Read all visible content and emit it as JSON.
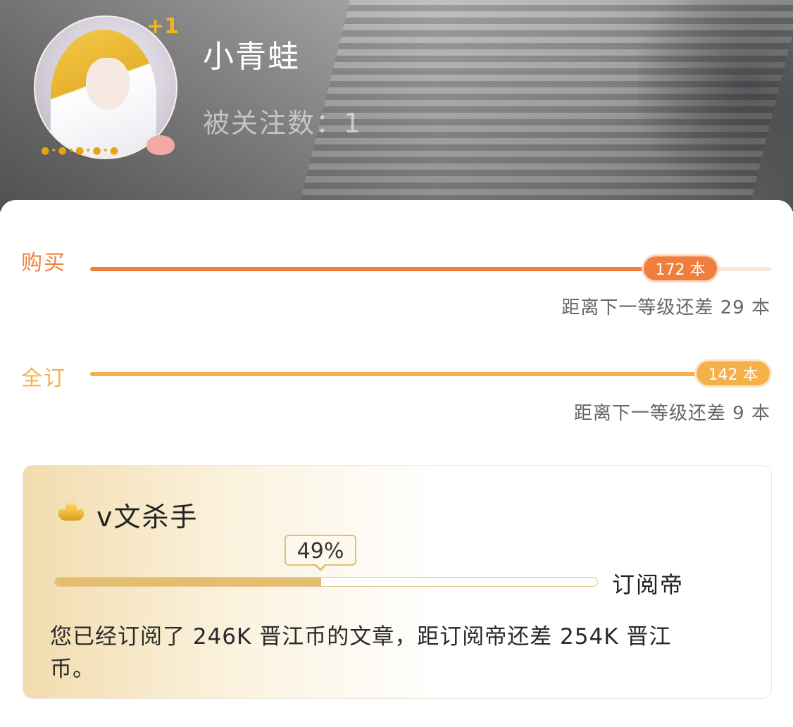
{
  "profile": {
    "username": "小青蛙",
    "followers": "被关注数：1",
    "avatar_badge": "+1"
  },
  "levels": {
    "buy": {
      "label": "购买",
      "count": "172 本",
      "progress_fraction": 0.855,
      "remaining_note": "距离下一等级还差 29 本",
      "color": "#f17e3c"
    },
    "subscribe": {
      "label": "全订",
      "count": "142 本",
      "progress_fraction": 0.94,
      "remaining_note": "距离下一等级还差 9 本",
      "color": "#f6b04a"
    }
  },
  "title_card": {
    "icon": "gold-ingot-icon",
    "title": "v文杀手",
    "progress_percent": 49,
    "progress_label": "49%",
    "next_title": "订阅帝",
    "description": "您已经订阅了 246K 晋江币的文章，距订阅帝还差 254K 晋江币。"
  }
}
